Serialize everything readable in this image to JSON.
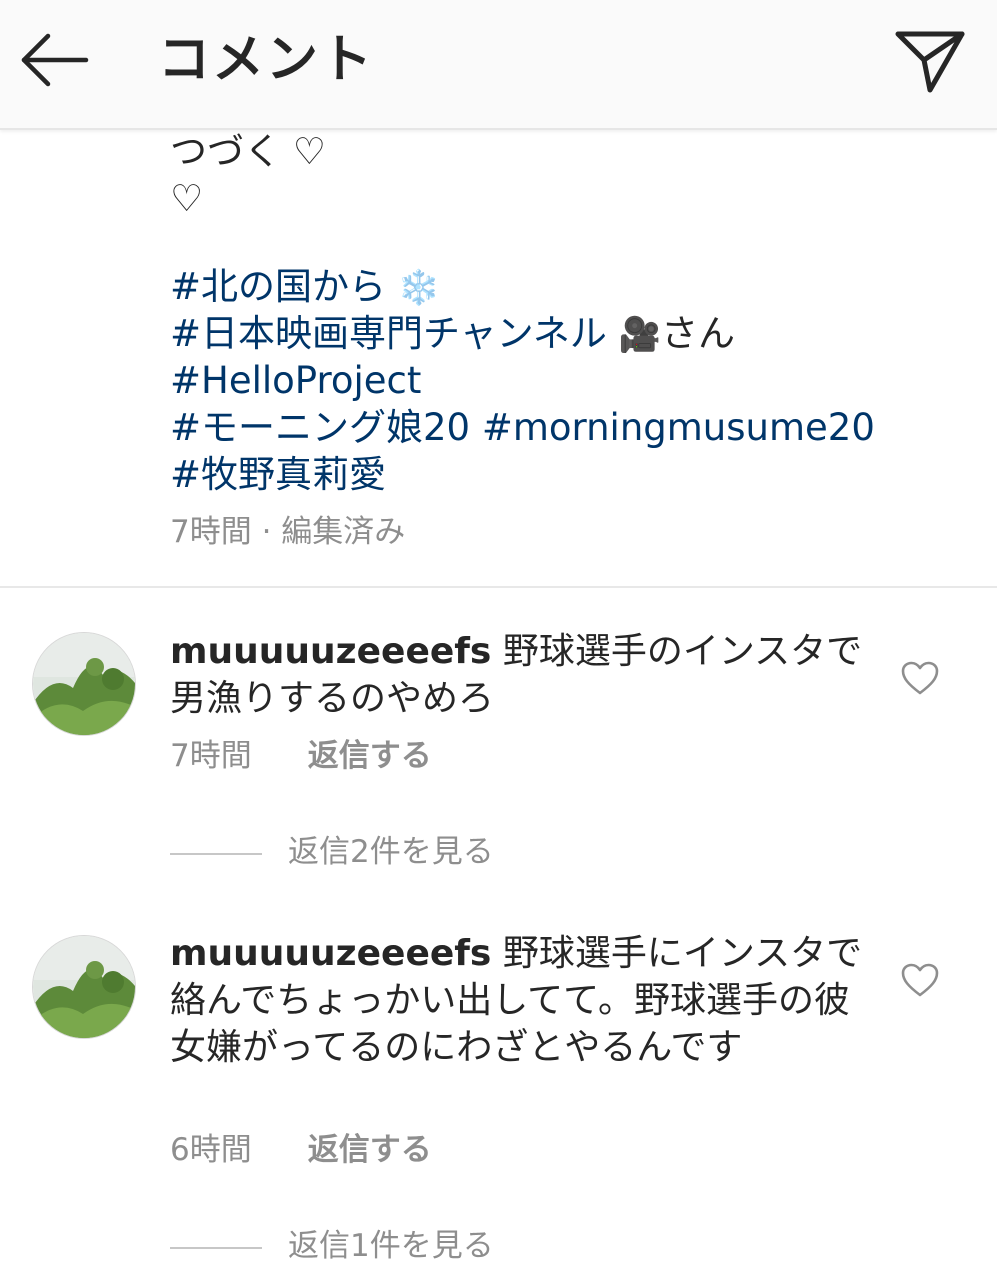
{
  "header": {
    "title": "コメント"
  },
  "caption": {
    "lines": [
      "つづく ♡",
      "♡"
    ],
    "tags": [
      {
        "tag": "#北の国から",
        "emoji": "❄️",
        "suffix": ""
      },
      {
        "tag": "#日本映画専門チャンネル",
        "emoji": "🎥",
        "suffix": "さん"
      },
      {
        "tag": "#HelloProject",
        "emoji": "",
        "suffix": ""
      },
      {
        "tag": "#モーニング娘20 #morningmusume20",
        "emoji": "",
        "suffix": ""
      },
      {
        "tag": "#牧野真莉愛",
        "emoji": "",
        "suffix": ""
      }
    ],
    "meta": "7時間 · 編集済み"
  },
  "comments": [
    {
      "username": "muuuuuzeeeefs",
      "text": "野球選手のインスタで男漁りするのやめろ",
      "time": "7時間",
      "reply_label": "返信する",
      "view_replies": "返信2件を見る"
    },
    {
      "username": "muuuuuzeeeefs",
      "text": "野球選手にインスタで絡んでちょっかい出してて。野球選手の彼女嫌がってるのにわざとやるんです",
      "time": "6時間",
      "reply_label": "返信する",
      "view_replies": "返信1件を見る"
    }
  ]
}
